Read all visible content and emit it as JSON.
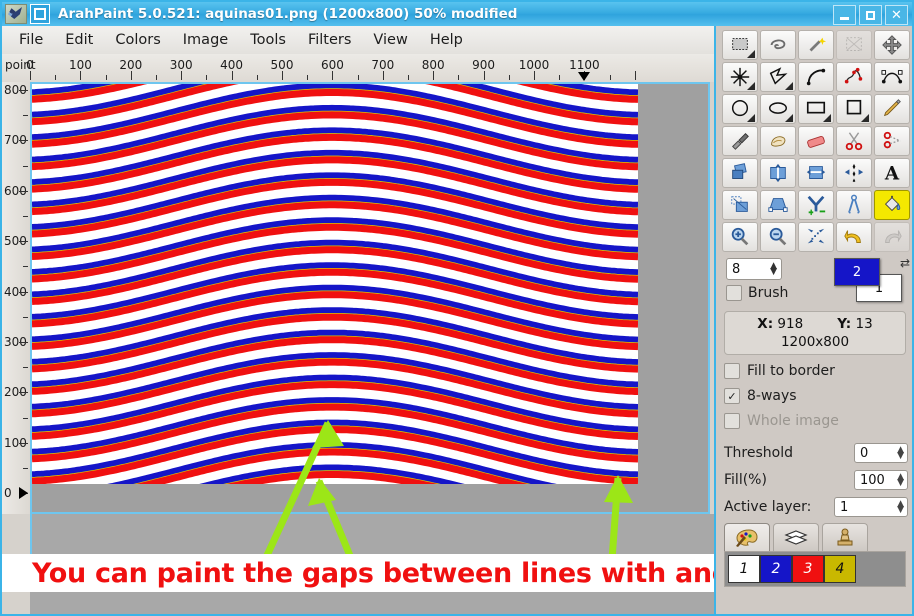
{
  "window": {
    "title": "ArahPaint 5.0.521: aquinas01.png  (1200x800) 50% modified",
    "app_icon": "leaf-icon",
    "doc_icon": "document-icon",
    "minimize": "–",
    "maximize": "□",
    "close": "✕",
    "titlebar_color": "#35a9e0"
  },
  "menu": {
    "items": [
      {
        "label": "File"
      },
      {
        "label": "Edit"
      },
      {
        "label": "Colors"
      },
      {
        "label": "Image"
      },
      {
        "label": "Tools"
      },
      {
        "label": "Filters"
      },
      {
        "label": "View"
      },
      {
        "label": "Help"
      }
    ]
  },
  "rulers": {
    "unit_label": "point",
    "h_labels": [
      "0",
      "100",
      "200",
      "300",
      "400",
      "500",
      "600",
      "700",
      "800",
      "900",
      "1000",
      "1100"
    ],
    "h_marker_value": "1100",
    "v_labels": [
      "800",
      "700",
      "600",
      "500",
      "400",
      "300",
      "200",
      "100",
      "0"
    ],
    "v_marker_value": "0"
  },
  "canvas": {
    "background": "#ffffff",
    "outside_color": "#a0a0a0",
    "pattern": {
      "line_colors": {
        "blue": "#1515c8",
        "red": "#f01010",
        "yellow": "#d8c400"
      },
      "rows": 19,
      "wave_description": "paired blue-over-red wavy lines with thin yellow core"
    },
    "annotation_arrows": [
      {
        "name": "arrow-left",
        "color": "#9ce617"
      },
      {
        "name": "arrow-middle",
        "color": "#9ce617"
      },
      {
        "name": "arrow-right",
        "color": "#9ce617"
      }
    ]
  },
  "caption": {
    "text": "You can paint the gaps between lines with another color.",
    "color": "#f01010"
  },
  "tools": {
    "rows": [
      [
        {
          "name": "rect-select-icon",
          "label": "Rectangle select",
          "state": "normal",
          "corner": true
        },
        {
          "name": "lasso-select-icon",
          "label": "Free select",
          "state": "normal",
          "corner": false
        },
        {
          "name": "magic-wand-icon",
          "label": "Magic wand",
          "state": "normal",
          "corner": false
        },
        {
          "name": "transform-icon",
          "label": "Transform",
          "state": "disabled",
          "corner": false
        },
        {
          "name": "move-icon",
          "label": "Move",
          "state": "normal",
          "corner": false
        }
      ],
      [
        {
          "name": "node-star-icon",
          "label": "Nodes",
          "state": "normal",
          "corner": true
        },
        {
          "name": "polygon-icon",
          "label": "Polygon",
          "state": "normal",
          "corner": true
        },
        {
          "name": "curve-icon",
          "label": "Curve",
          "state": "normal",
          "corner": false
        },
        {
          "name": "freehand-points-icon",
          "label": "Freehand points",
          "state": "normal",
          "corner": false
        },
        {
          "name": "bezier-icon",
          "label": "Bezier",
          "state": "normal",
          "corner": false
        }
      ],
      [
        {
          "name": "circle-icon",
          "label": "Circle",
          "state": "normal",
          "corner": true
        },
        {
          "name": "ellipse-icon",
          "label": "Ellipse",
          "state": "normal",
          "corner": true
        },
        {
          "name": "rectangle-icon",
          "label": "Rectangle",
          "state": "normal",
          "corner": true
        },
        {
          "name": "square-icon",
          "label": "Square",
          "state": "normal",
          "corner": true
        },
        {
          "name": "pencil-icon",
          "label": "Pencil",
          "state": "normal",
          "corner": false
        }
      ],
      [
        {
          "name": "airbrush-icon",
          "label": "Airbrush",
          "state": "normal",
          "corner": false
        },
        {
          "name": "smudge-icon",
          "label": "Smudge",
          "state": "normal",
          "corner": false
        },
        {
          "name": "eraser-icon",
          "label": "Eraser",
          "state": "normal",
          "corner": false
        },
        {
          "name": "scissors-icon",
          "label": "Cut",
          "state": "normal",
          "corner": false
        },
        {
          "name": "scissors-dashed-icon",
          "label": "Cut along path",
          "state": "normal",
          "corner": false
        }
      ],
      [
        {
          "name": "duplicate-icon",
          "label": "Duplicate",
          "state": "normal",
          "corner": false
        },
        {
          "name": "flip-vertical-icon",
          "label": "Flip vertical",
          "state": "normal",
          "corner": false
        },
        {
          "name": "flip-horizontal-icon",
          "label": "Flip horizontal",
          "state": "normal",
          "corner": false
        },
        {
          "name": "mirror-icon",
          "label": "Mirror",
          "state": "normal",
          "corner": false
        },
        {
          "name": "text-icon",
          "label": "Text",
          "state": "normal",
          "corner": false
        }
      ],
      [
        {
          "name": "scale-icon",
          "label": "Scale",
          "state": "normal",
          "corner": false
        },
        {
          "name": "perspective-icon",
          "label": "Perspective",
          "state": "normal",
          "corner": false
        },
        {
          "name": "merge-split-icon",
          "label": "Merge/split",
          "state": "normal",
          "corner": false
        },
        {
          "name": "compass-icon",
          "label": "Measure",
          "state": "normal",
          "corner": false
        },
        {
          "name": "fill-bucket-icon",
          "label": "Fill",
          "state": "active",
          "corner": false
        }
      ],
      [
        {
          "name": "zoom-in-icon",
          "label": "Zoom in",
          "state": "normal",
          "corner": false
        },
        {
          "name": "zoom-out-icon",
          "label": "Zoom out",
          "state": "normal",
          "corner": false
        },
        {
          "name": "fit-icon",
          "label": "Fit to window",
          "state": "normal",
          "corner": false
        },
        {
          "name": "undo-icon",
          "label": "Undo",
          "state": "normal",
          "corner": false
        },
        {
          "name": "redo-icon",
          "label": "Redo",
          "state": "disabled",
          "corner": false
        }
      ]
    ]
  },
  "options": {
    "size_value": "8",
    "brush_label": "Brush",
    "brush_checked": false,
    "fg_color_index": "2",
    "bg_color_index": "1",
    "fg_color": "#1515c8",
    "bg_color": "#ffffff",
    "swap_icon": "swap-colors-icon",
    "coord_x_label": "X:",
    "coord_x_value": "918",
    "coord_y_label": "Y:",
    "coord_y_value": "13",
    "image_size": "1200x800",
    "fill_to_border_label": "Fill to border",
    "fill_to_border_checked": false,
    "eight_ways_label": "8-ways",
    "eight_ways_checked": true,
    "whole_image_label": "Whole image",
    "whole_image_checked": false,
    "whole_image_disabled": true,
    "threshold_label": "Threshold",
    "threshold_value": "0",
    "fill_label": "Fill(%)",
    "fill_value": "100",
    "active_layer_label": "Active layer:",
    "active_layer_value": "1"
  },
  "palette": {
    "tabs": [
      {
        "name": "palette-tab",
        "icon": "palette-icon",
        "active": true
      },
      {
        "name": "layers-tab",
        "icon": "layers-icon",
        "active": false
      },
      {
        "name": "stamp-tab",
        "icon": "stamp-icon",
        "active": false
      }
    ],
    "colors": [
      {
        "index": "1",
        "hex": "#ffffff",
        "text": "#111111"
      },
      {
        "index": "2",
        "hex": "#1515c8",
        "text": "#ffffff"
      },
      {
        "index": "3",
        "hex": "#f01010",
        "text": "#ffffff"
      },
      {
        "index": "4",
        "hex": "#c9b800",
        "text": "#111111"
      }
    ]
  }
}
